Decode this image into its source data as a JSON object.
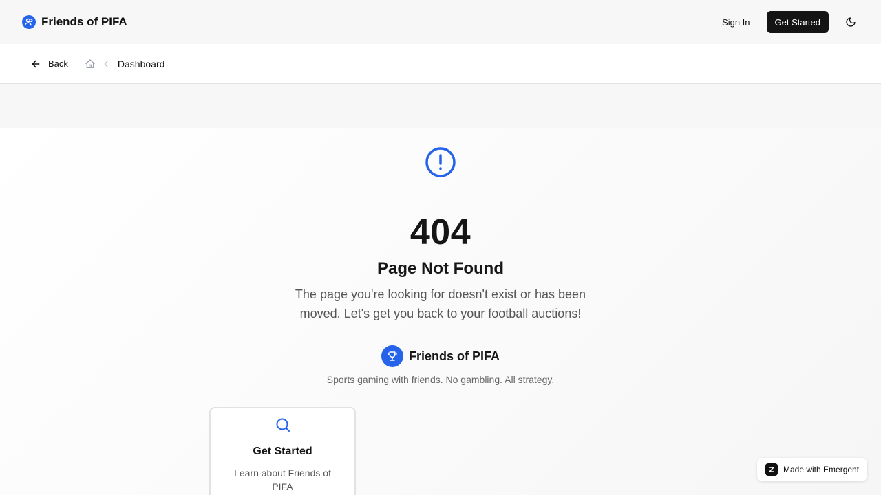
{
  "header": {
    "brand": "Friends of PIFA",
    "sign_in": "Sign In",
    "get_started": "Get Started",
    "theme_icon": "moon-icon"
  },
  "breadcrumb": {
    "back": "Back",
    "home_icon": "home-icon",
    "current": "Dashboard"
  },
  "error": {
    "code": "404",
    "title": "Page Not Found",
    "description": "The page you're looking for doesn't exist or has been moved. Let's get you back to your football auctions!"
  },
  "brand_block": {
    "name": "Friends of PIFA",
    "tagline": "Sports gaming with friends. No gambling. All strategy."
  },
  "cards": [
    {
      "icon": "search-icon",
      "title": "Get Started",
      "description": "Learn about Friends of PIFA"
    }
  ],
  "badge": {
    "text": "Made with Emergent"
  },
  "colors": {
    "accent": "#2563eb",
    "dark_button": "#141414"
  }
}
